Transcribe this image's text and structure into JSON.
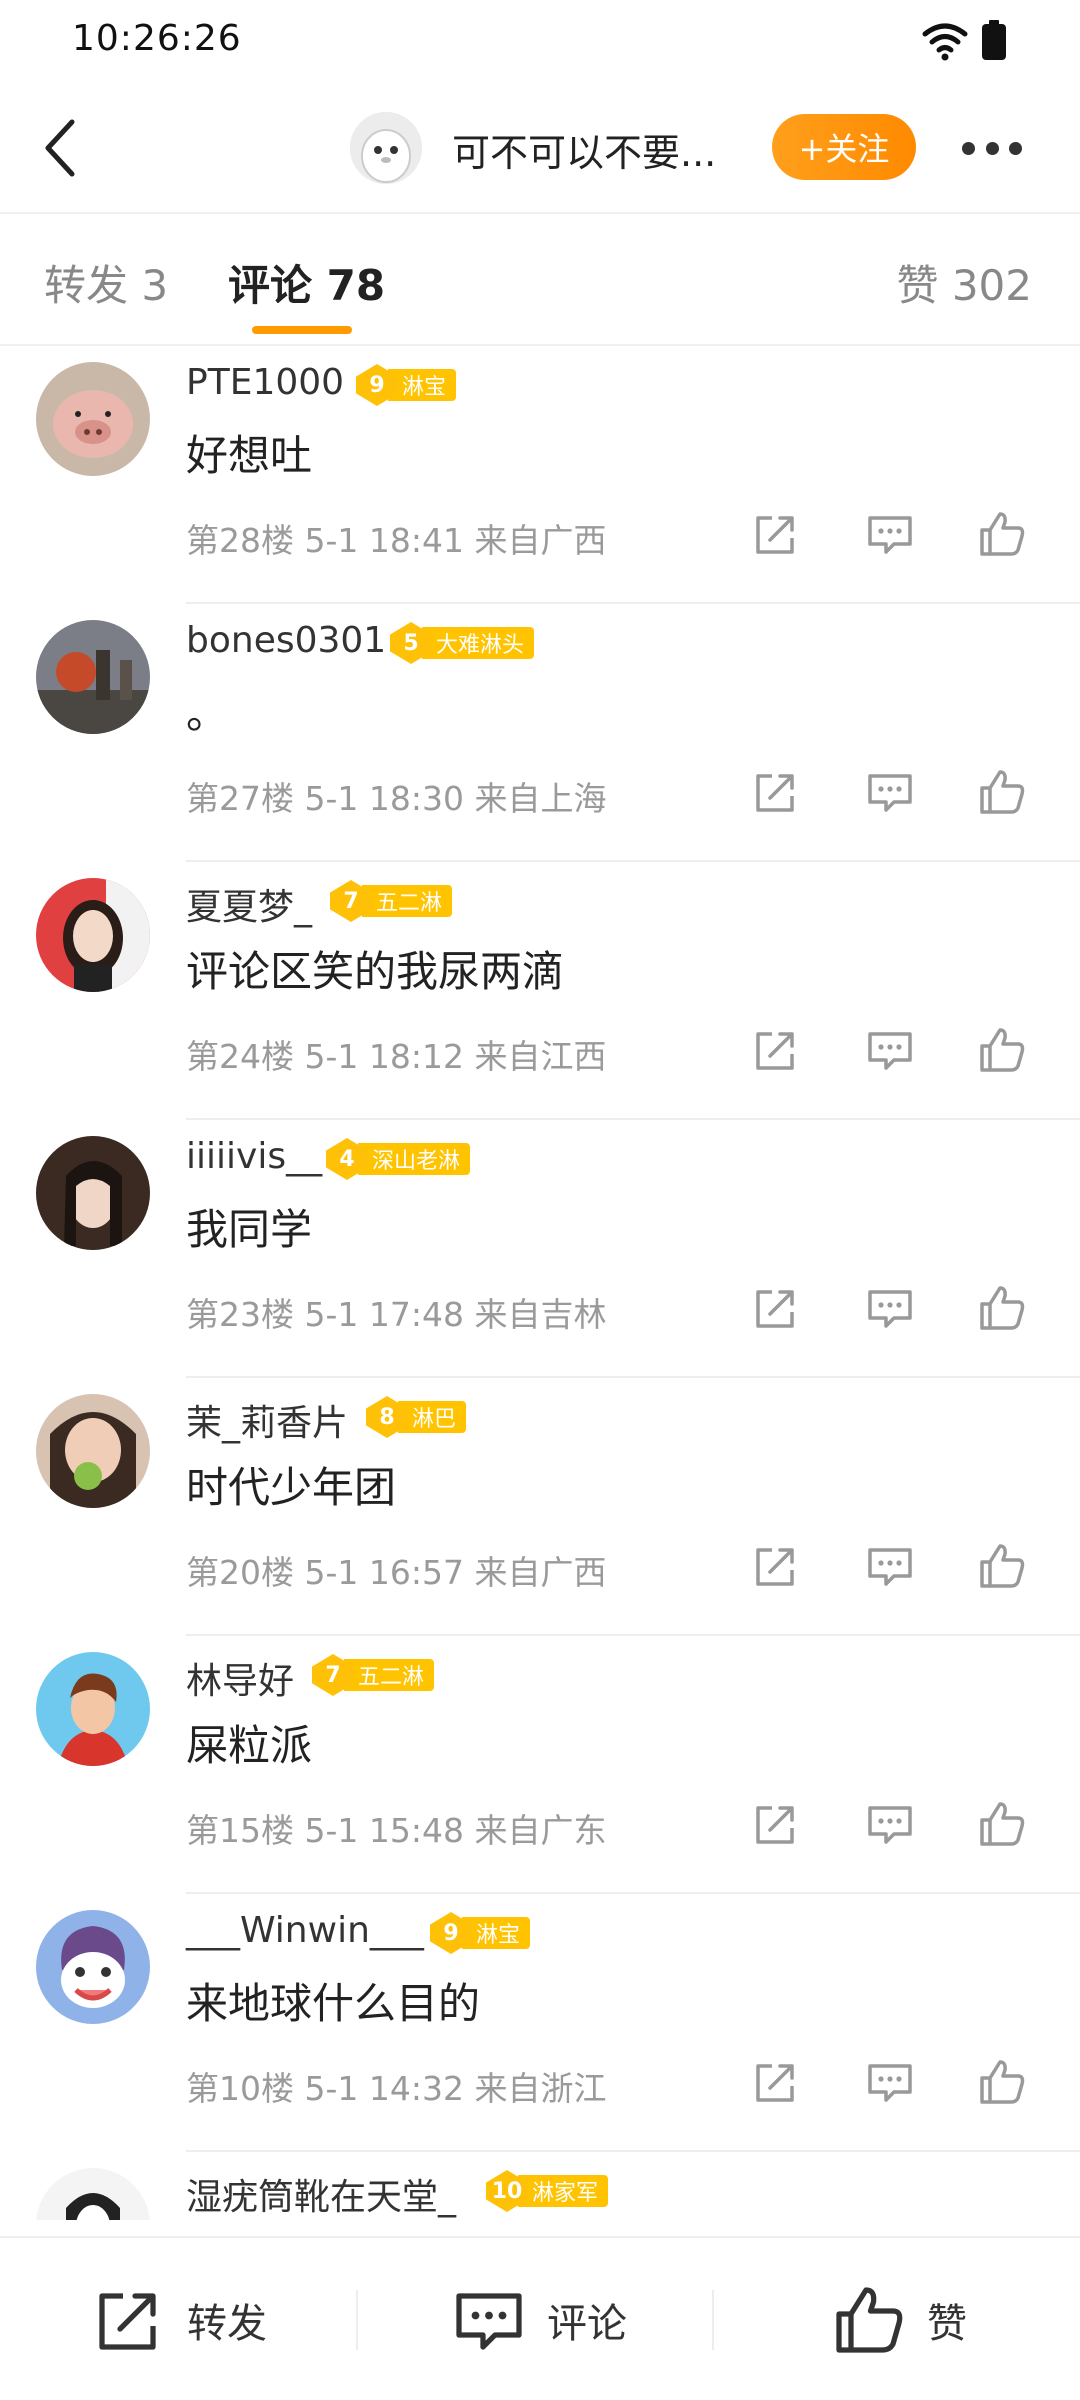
{
  "status": {
    "time": "10:26:26"
  },
  "header": {
    "title": "可不可以不要...",
    "follow_label": "+关注"
  },
  "tabs": {
    "repost": "转发 3",
    "comments": "评论 78",
    "likes": "赞 302"
  },
  "comments": [
    {
      "user": "PTE1000",
      "level": "9",
      "badge": "淋宝",
      "text": "好想吐",
      "meta": "第28楼  5-1 18:41  来自广西"
    },
    {
      "user": "bones0301",
      "level": "5",
      "badge": "大难淋头",
      "text": "。",
      "meta": "第27楼  5-1 18:30  来自上海"
    },
    {
      "user": "夏夏梦_",
      "level": "7",
      "badge": "五二淋",
      "text": "评论区笑的我尿两滴",
      "meta": "第24楼  5-1 18:12  来自江西"
    },
    {
      "user": "iiiiivis__",
      "level": "4",
      "badge": "深山老淋",
      "text": "我同学",
      "meta": "第23楼  5-1 17:48  来自吉林"
    },
    {
      "user": "茉_莉香片",
      "level": "8",
      "badge": "淋巴",
      "text": "时代少年团",
      "meta": "第20楼  5-1 16:57  来自广西"
    },
    {
      "user": "林导好",
      "level": "7",
      "badge": "五二淋",
      "text": "屎粒派",
      "meta": "第15楼  5-1 15:48  来自广东"
    },
    {
      "user": "___Winwin___",
      "level": "9",
      "badge": "淋宝",
      "text": "来地球什么目的",
      "meta": "第10楼  5-1 14:32  来自浙江"
    },
    {
      "user": "湿疣筒靴在天堂_",
      "level": "10",
      "badge": "淋家军",
      "text": "",
      "meta": ""
    }
  ],
  "bottom": {
    "repost": "转发",
    "comment": "评论",
    "like": "赞"
  },
  "colors": {
    "accent": "#ff9a00",
    "badge": "#ffc300"
  }
}
